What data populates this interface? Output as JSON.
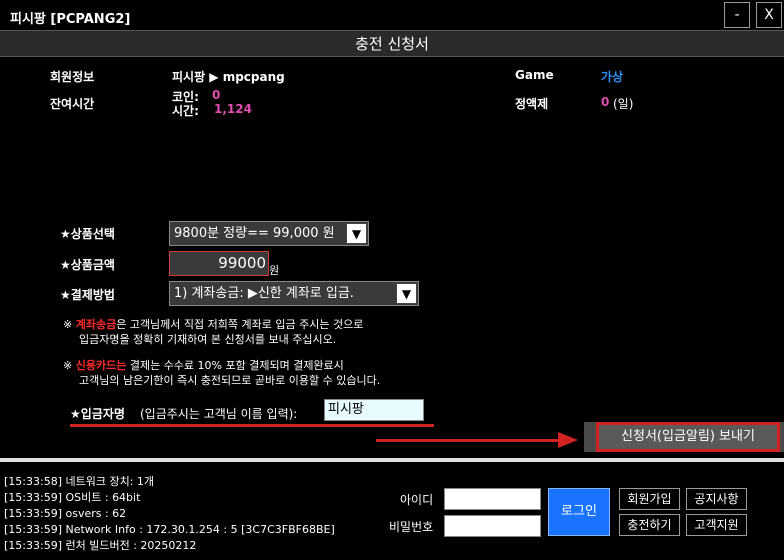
{
  "window": {
    "title": "피시팡 [PCPANG2]",
    "minimize_label": "-",
    "close_label": "X"
  },
  "form": {
    "title": "충전 신청서"
  },
  "member": {
    "info_label": "회원정보",
    "info_value": "피시팡 ▶ mpcpang",
    "remaining_label": "잔여시간",
    "coin_label": "코인:",
    "coin_value": "0",
    "time_label": "시간:",
    "time_value": "1,124",
    "game_label": "Game",
    "game_value": "가상",
    "fixed_label": "정액제",
    "fixed_value": "0",
    "fixed_unit": "(일)"
  },
  "order": {
    "product_label": "★상품선택",
    "product_value": "9800분 정량== 99,000 원",
    "amount_label": "★상품금액",
    "amount_value": "99000",
    "amount_unit": "원",
    "payment_label": "★결제방법",
    "payment_value": "1) 계좌송금: ▶신한 계좌로 입금.",
    "note1_prefix": "※ ",
    "note1_highlight": "계좌송금",
    "note1_line1": "은 고객님께서  직접 저희쪽 계좌로 입금 주시는 것으로",
    "note1_line2": "입금자명을 정확히 기재하여   본  신청서를 보내 주십시오.",
    "note2_prefix": "※ ",
    "note2_highlight": "신용카드는",
    "note2_line1": " 결제는 수수료 10% 포함 결제되며 결제완료시",
    "note2_line2": "고객님의 남은기한이 즉시 충전되므로 곧바로 이용할 수 있습니다.",
    "depositor_label": "★입금자명",
    "depositor_hint": "(입금주시는 고객님 이름 입력):",
    "depositor_value": "피시팡",
    "submit_label": "신청서(입금알림) 보내기"
  },
  "log": [
    "[15:33:58] 네트워크 장치: 1개",
    "[15:33:59] OS비트 : 64bit",
    "[15:33:59] osvers : 62",
    "[15:33:59] Network Info : 172.30.1.254 : 5 [3C7C3FBF68BE]",
    "[15:33:59] 런처 빌드버전 : 20250212"
  ],
  "login": {
    "id_label": "아이디",
    "pw_label": "비밀번호",
    "login_button": "로그인",
    "signup_button": "회원가입",
    "notice_button": "공지사항",
    "charge_button": "충전하기",
    "support_button": "고객지원"
  },
  "colors": {
    "accent_red": "#d12222",
    "value_pink": "#e04db0",
    "value_blue": "#2e8ff5",
    "login_blue": "#1a73ff"
  }
}
